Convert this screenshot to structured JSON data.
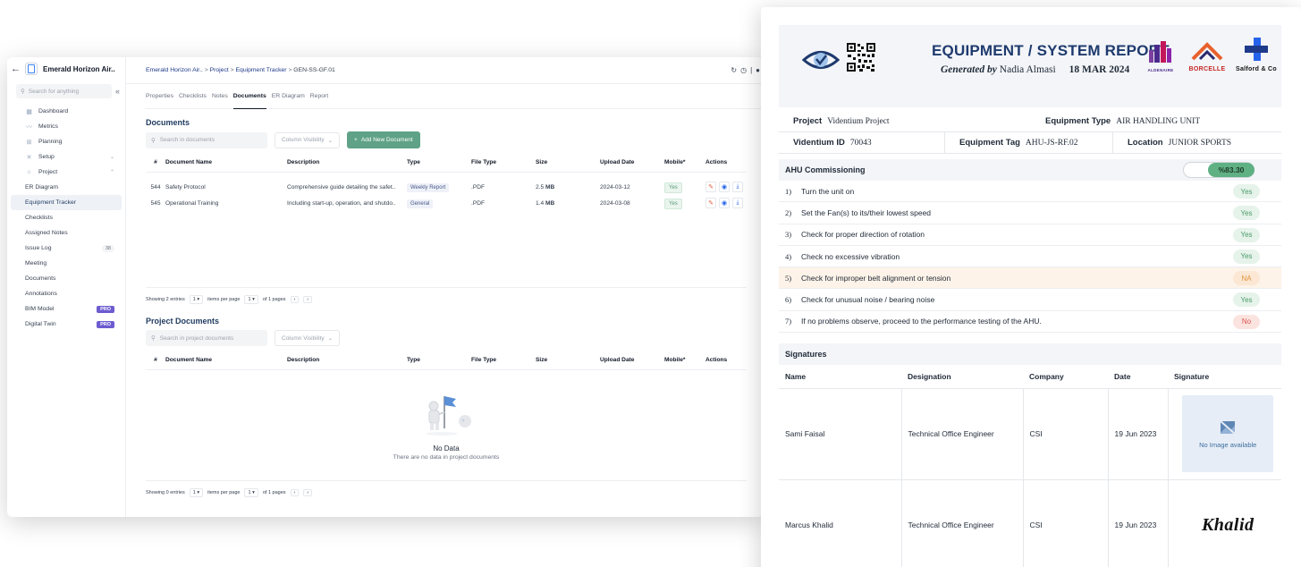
{
  "app": {
    "title": "Emerald Horizon Air..",
    "search_placeholder": "Search for anything",
    "breadcrumb": [
      {
        "label": "Emerald Horizon Air.."
      },
      {
        "label": "Project"
      },
      {
        "label": "Equipment Tracker"
      },
      {
        "label": "GEN-SS-GF.01"
      }
    ],
    "sidebar": {
      "items": [
        {
          "label": "Dashboard",
          "icon": "dashboard-icon"
        },
        {
          "label": "Metrics",
          "icon": "metrics-icon"
        },
        {
          "label": "Planning",
          "icon": "planning-icon"
        },
        {
          "label": "Setup",
          "icon": "setup-icon"
        },
        {
          "label": "Project",
          "icon": "project-icon"
        }
      ],
      "project_items": [
        {
          "label": "ER Diagram"
        },
        {
          "label": "Equipment Tracker",
          "active": true
        },
        {
          "label": "Checklists"
        },
        {
          "label": "Assigned Notes"
        },
        {
          "label": "Issue Log",
          "count": "38"
        },
        {
          "label": "Meeting"
        },
        {
          "label": "Documents"
        },
        {
          "label": "Annotations"
        },
        {
          "label": "BIM Model",
          "badge": "PRO"
        },
        {
          "label": "Digital Twin",
          "badge": "PRO"
        }
      ]
    },
    "tabs": [
      "Properties",
      "Checklists",
      "Notes",
      "Documents",
      "ER Diagram",
      "Report"
    ],
    "active_tab": "Documents",
    "documents": {
      "title": "Documents",
      "search_placeholder": "Search in documents",
      "column_visibility": "Column Visibility",
      "add_button": "Add New Document",
      "columns": [
        "#",
        "Document Name",
        "Description",
        "Type",
        "File Type",
        "Size",
        "Upload Date",
        "Mobile*",
        "Actions"
      ],
      "rows": [
        {
          "id": "544",
          "name": "Safety Protocol",
          "description": "Comprehensive guide detailing the safet..",
          "type": "Weekly Report",
          "file_type": ".PDF",
          "size": "2.5",
          "size_unit": "MB",
          "upload_date": "2024-03-12",
          "mobile": "Yes"
        },
        {
          "id": "545",
          "name": "Operational Training",
          "description": "Including start-up, operation, and shutdo..",
          "type": "General",
          "file_type": ".PDF",
          "size": "1.4",
          "size_unit": "MB",
          "upload_date": "2024-03-08",
          "mobile": "Yes"
        }
      ],
      "pager": {
        "showing": "Showing 2 entries",
        "per_page": "1",
        "per_page_label": "items per page",
        "page": "1",
        "of_pages": "of 1 pages"
      }
    },
    "project_documents": {
      "title": "Project Documents",
      "search_placeholder": "Search in project documents",
      "column_visibility": "Column Visibility",
      "columns": [
        "#",
        "Document Name",
        "Description",
        "Type",
        "File Type",
        "Size",
        "Upload Date",
        "Mobile*",
        "Actions"
      ],
      "empty_title": "No Data",
      "empty_text": "There are no data in project documents",
      "pager": {
        "showing": "Showing 0 entries",
        "per_page": "1",
        "per_page_label": "items per page",
        "page": "1",
        "of_pages": "of 1 pages"
      }
    }
  },
  "report": {
    "title": "EQUIPMENT / SYSTEM REPORT",
    "generated_by_label": "Generated by",
    "generated_by": "Nadia Almasi",
    "date": "18 MAR 2024",
    "brands": [
      "ALDENAIRE",
      "BORCELLE",
      "Salford & Co"
    ],
    "info": {
      "project_label": "Project",
      "project": "Videntium Project",
      "equipment_type_label": "Equipment Type",
      "equipment_type": "AIR HANDLING UNIT",
      "videntium_id_label": "Videntium ID",
      "videntium_id": "70043",
      "equipment_tag_label": "Equipment Tag",
      "equipment_tag": "AHU-JS-RF.02",
      "location_label": "Location",
      "location": "JUNIOR SPORTS"
    },
    "commissioning": {
      "title": "AHU Commissioning",
      "percent_label": "%83.30",
      "percent": 83.3,
      "items": [
        {
          "num": "1)",
          "text": "Turn the unit on",
          "answer": "Yes"
        },
        {
          "num": "2)",
          "text": "Set the Fan(s) to its/their lowest speed",
          "answer": "Yes"
        },
        {
          "num": "3)",
          "text": "Check for proper direction of rotation",
          "answer": "Yes"
        },
        {
          "num": "4)",
          "text": "Check no excessive vibration",
          "answer": "Yes"
        },
        {
          "num": "5)",
          "text": "Check for improper belt alignment or tension",
          "answer": "NA"
        },
        {
          "num": "6)",
          "text": "Check for unusual noise / bearing noise",
          "answer": "Yes"
        },
        {
          "num": "7)",
          "text": "If no problems observe, proceed to the performance testing of the AHU.",
          "answer": "No"
        }
      ]
    },
    "signatures": {
      "title": "Signatures",
      "columns": [
        "Name",
        "Designation",
        "Company",
        "Date",
        "Signature"
      ],
      "rows": [
        {
          "name": "Sami Faisal",
          "designation": "Technical Office Engineer",
          "company": "CSI",
          "date": "19 Jun 2023",
          "signature": "No Image available"
        },
        {
          "name": "Marcus Khalid",
          "designation": "Technical Office Engineer",
          "company": "CSI",
          "date": "19 Jun 2023",
          "signature": "Khalid"
        }
      ]
    }
  }
}
